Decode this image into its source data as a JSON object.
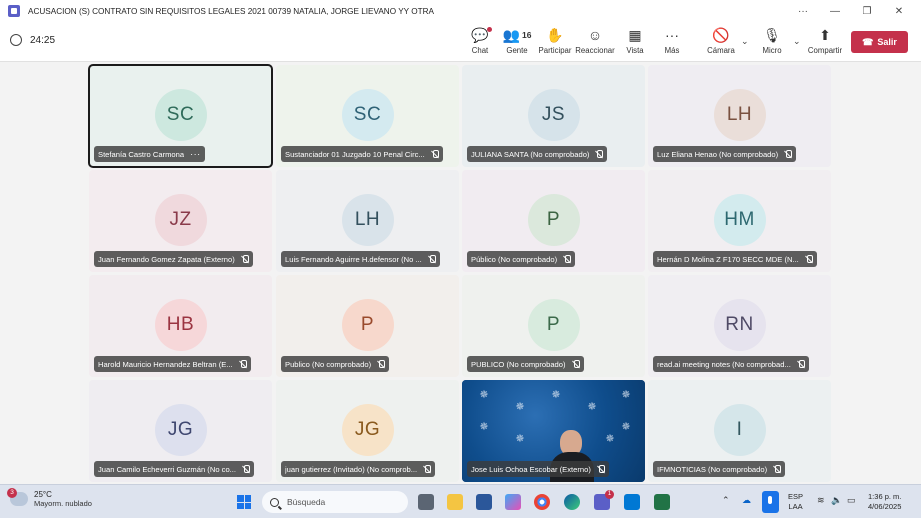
{
  "window": {
    "title": "ACUSACION (S) CONTRATO SIN REQUISITOS LEGALES 2021 00739 NATALIA, JORGE LIEVANO YY OTRA",
    "more": "···",
    "minimize": "—",
    "maximize": "❐",
    "close": "✕"
  },
  "toolbar": {
    "timer": "24:25",
    "chat": "Chat",
    "people": "Gente",
    "people_count": "16",
    "raise": "Participar",
    "react": "Reaccionar",
    "view": "Vista",
    "more": "Más",
    "camera": "Cámara",
    "mic": "Micro",
    "share": "Compartir",
    "leave": "Salir"
  },
  "participants": [
    {
      "initials": "SC",
      "name": "Stefanía Castro Carmona",
      "bg": "#e9f1ee",
      "avatar_bg": "#cde8df",
      "avatar_fg": "#2f6b5a"
    },
    {
      "initials": "SC",
      "name": "Sustanciador 01 Juzgado 10 Penal Circ...",
      "bg": "#eef3ec",
      "avatar_bg": "#d4eaf0",
      "avatar_fg": "#2f6276"
    },
    {
      "initials": "JS",
      "name": "JULIANA SANTA (No comprobado)",
      "bg": "#e9eef0",
      "avatar_bg": "#d6e3ea",
      "avatar_fg": "#33505d"
    },
    {
      "initials": "LH",
      "name": "Luz Eliana Henao (No comprobado)",
      "bg": "#efedf2",
      "avatar_bg": "#eaded9",
      "avatar_fg": "#7a5140"
    },
    {
      "initials": "JZ",
      "name": "Juan Fernando Gomez Zapata (Externo)",
      "bg": "#f3ecef",
      "avatar_bg": "#f0d9dd",
      "avatar_fg": "#8a3a4a"
    },
    {
      "initials": "LH",
      "name": "Luis Fernando Aguirre H.defensor (No ...",
      "bg": "#eeeff1",
      "avatar_bg": "#d9e3ea",
      "avatar_fg": "#33505d"
    },
    {
      "initials": "P",
      "name": "Público (No comprobado)",
      "bg": "#f1ecf1",
      "avatar_bg": "#dbe8dc",
      "avatar_fg": "#3b6442"
    },
    {
      "initials": "HM",
      "name": "Hernán D Molina Z F170 SECC MDE (N...",
      "bg": "#f1eef1",
      "avatar_bg": "#d3ebee",
      "avatar_fg": "#2d6870"
    },
    {
      "initials": "HB",
      "name": "Harold Mauricio Hernandez Beltran (E...",
      "bg": "#f2ecef",
      "avatar_bg": "#f6d7d9",
      "avatar_fg": "#9b3441"
    },
    {
      "initials": "P",
      "name": "Publico (No comprobado)",
      "bg": "#f2efec",
      "avatar_bg": "#f7d8cc",
      "avatar_fg": "#9a4a2c"
    },
    {
      "initials": "P",
      "name": "PUBLICO (No comprobado)",
      "bg": "#eff1ee",
      "avatar_bg": "#d8ebde",
      "avatar_fg": "#3b6a4a"
    },
    {
      "initials": "RN",
      "name": "read.ai meeting notes (No comprobad...",
      "bg": "#f0eef2",
      "avatar_bg": "#e6e3ee",
      "avatar_fg": "#4f4a66"
    },
    {
      "initials": "JG",
      "name": "Juan Camilo Echeverri Guzmán (No co...",
      "bg": "#efedf1",
      "avatar_bg": "#dde0ee",
      "avatar_fg": "#3f4770"
    },
    {
      "initials": "JG",
      "name": "juan gutierrez (Invitado) (No comprob...",
      "bg": "#eef1ef",
      "avatar_bg": "#f7e3c8",
      "avatar_fg": "#8a5a1e"
    },
    {
      "initials": "",
      "name": "Jose Luis Ochoa Escobar (Externo)",
      "bg": "#0d4b8a",
      "avatar_bg": "",
      "avatar_fg": ""
    },
    {
      "initials": "I",
      "name": "IFMNOTICIAS (No comprobado)",
      "bg": "#ecf0f1",
      "avatar_bg": "#d5e6ea",
      "avatar_fg": "#33575f"
    }
  ],
  "taskbar": {
    "weather_badge": "3",
    "temperature": "25°C",
    "condition": "Mayorm. nublado",
    "search_placeholder": "Búsqueda",
    "mail_badge": "1",
    "lang_1": "ESP",
    "lang_2": "LAA",
    "time": "1:36 p. m.",
    "date": "4/06/2025"
  }
}
